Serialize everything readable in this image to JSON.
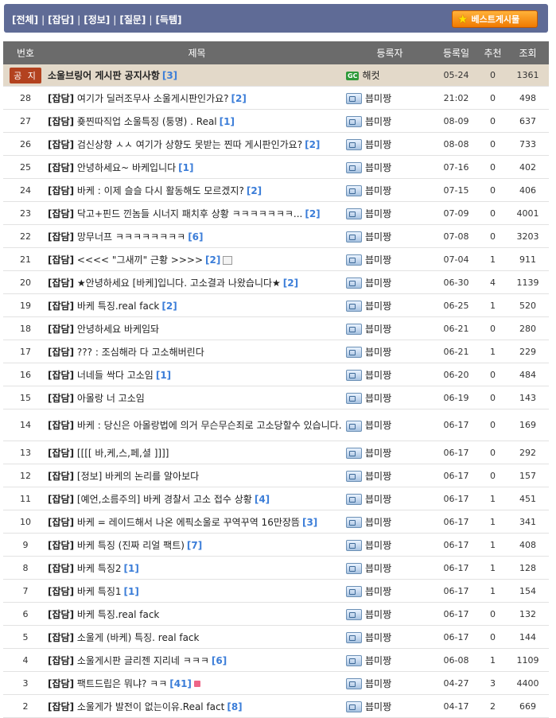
{
  "categories": [
    "[전체]",
    "[잡담]",
    "[정보]",
    "[질문]",
    "[득템]"
  ],
  "category_separator": "|",
  "best_button": {
    "label": "베스트게시물"
  },
  "columns": {
    "num": "번호",
    "title": "제목",
    "author": "등록자",
    "date": "등록일",
    "rec": "추천",
    "views": "조회"
  },
  "notice": {
    "badge": "공 지",
    "title": "소울브링어 게시판 공지사항",
    "comments": "[3]",
    "author": "해컷",
    "date": "05-24",
    "rec": "0",
    "views": "1361"
  },
  "posts": [
    {
      "num": "28",
      "cat": "[잡담]",
      "title": "여기가 딜러조무사 소울게시판인가요?",
      "comments": "[2]",
      "author": "븝미짱",
      "date": "21:02",
      "rec": "0",
      "views": "498"
    },
    {
      "num": "27",
      "cat": "[잡담]",
      "title": "죶찐따직업 소울특징 (퉁명) . Real",
      "comments": "[1]",
      "author": "븝미짱",
      "date": "08-09",
      "rec": "0",
      "views": "637"
    },
    {
      "num": "26",
      "cat": "[잡담]",
      "title": "검신상향 ㅅㅅ 여기가 상향도 못받는 찐따 게시판인가요?",
      "comments": "[2]",
      "author": "븝미짱",
      "date": "08-08",
      "rec": "0",
      "views": "733"
    },
    {
      "num": "25",
      "cat": "[잡담]",
      "title": "안녕하세요~ 바케입니다",
      "comments": "[1]",
      "author": "븝미짱",
      "date": "07-16",
      "rec": "0",
      "views": "402"
    },
    {
      "num": "24",
      "cat": "[잡담]",
      "title": "바케 : 이제 슬슬 다시 활동해도 모르겠지?",
      "comments": "[2]",
      "author": "븝미짱",
      "date": "07-15",
      "rec": "0",
      "views": "406"
    },
    {
      "num": "23",
      "cat": "[잡담]",
      "title": "닥고+핀드 낀놈들 시너지 패치후 상황 ㅋㅋㅋㅋㅋㅋㅋ...",
      "comments": "[2]",
      "author": "븝미짱",
      "date": "07-09",
      "rec": "0",
      "views": "4001"
    },
    {
      "num": "22",
      "cat": "[잡담]",
      "title": "망무너프 ㅋㅋㅋㅋㅋㅋㅋㅋ",
      "comments": "[6]",
      "author": "븝미짱",
      "date": "07-08",
      "rec": "0",
      "views": "3203"
    },
    {
      "num": "21",
      "cat": "[잡담]",
      "title": "<<<< \"그새끼\" 근황 >>>>",
      "comments": "[2]",
      "author": "븝미짱",
      "date": "07-04",
      "rec": "1",
      "views": "911",
      "img": true
    },
    {
      "num": "20",
      "cat": "[잡담]",
      "title": "★안녕하세요 [바케]입니다. 고소결과 나왔습니다★",
      "comments": "[2]",
      "author": "븝미짱",
      "date": "06-30",
      "rec": "4",
      "views": "1139"
    },
    {
      "num": "19",
      "cat": "[잡담]",
      "title": "바케 특징.real fack",
      "comments": "[2]",
      "author": "븝미짱",
      "date": "06-25",
      "rec": "1",
      "views": "520"
    },
    {
      "num": "18",
      "cat": "[잡담]",
      "title": "안녕하세요 바케임돠",
      "comments": "",
      "author": "븝미짱",
      "date": "06-21",
      "rec": "0",
      "views": "280"
    },
    {
      "num": "17",
      "cat": "[잡담]",
      "title": "??? : 조심해라 다 고소해버린다",
      "comments": "",
      "author": "븝미짱",
      "date": "06-21",
      "rec": "1",
      "views": "229"
    },
    {
      "num": "16",
      "cat": "[잡담]",
      "title": "너네들 싹다 고소임",
      "comments": "[1]",
      "author": "븝미짱",
      "date": "06-20",
      "rec": "0",
      "views": "484"
    },
    {
      "num": "15",
      "cat": "[잡담]",
      "title": "아몰랑 너 고소임",
      "comments": "",
      "author": "븝미짱",
      "date": "06-19",
      "rec": "0",
      "views": "143"
    },
    {
      "num": "14",
      "cat": "[잡담]",
      "title": "바케 : 당신은 아몰랑법에 의거 무슨무슨죄로 고소당할수 있습니다.",
      "comments": "",
      "author": "븝미짱",
      "date": "06-17",
      "rec": "0",
      "views": "169",
      "tall": true
    },
    {
      "num": "13",
      "cat": "[잡담]",
      "title": "[[[[ 바,케,스,페,셜 ]]]]",
      "comments": "",
      "author": "븝미짱",
      "date": "06-17",
      "rec": "0",
      "views": "292"
    },
    {
      "num": "12",
      "cat": "[잡담]",
      "title": "[정보] 바케의 논리를 알아보다",
      "comments": "",
      "author": "븝미짱",
      "date": "06-17",
      "rec": "0",
      "views": "157"
    },
    {
      "num": "11",
      "cat": "[잡담]",
      "title": "[예언,소름주의] 바케 경찰서 고소 접수 상황",
      "comments": "[4]",
      "author": "븝미짱",
      "date": "06-17",
      "rec": "1",
      "views": "451"
    },
    {
      "num": "10",
      "cat": "[잡담]",
      "title": "바케 = 레이드해서 나온 에픽소울로 꾸역꾸역 16만장뜸",
      "comments": "[3]",
      "author": "븝미짱",
      "date": "06-17",
      "rec": "1",
      "views": "341"
    },
    {
      "num": "9",
      "cat": "[잡담]",
      "title": "바케 특징 (진짜 리얼 팩트)",
      "comments": "[7]",
      "author": "븝미짱",
      "date": "06-17",
      "rec": "1",
      "views": "408"
    },
    {
      "num": "8",
      "cat": "[잡담]",
      "title": "바케 특징2",
      "comments": "[1]",
      "author": "븝미짱",
      "date": "06-17",
      "rec": "1",
      "views": "128"
    },
    {
      "num": "7",
      "cat": "[잡담]",
      "title": "바케 특징1",
      "comments": "[1]",
      "author": "븝미짱",
      "date": "06-17",
      "rec": "1",
      "views": "154"
    },
    {
      "num": "6",
      "cat": "[잡담]",
      "title": "바케 특징.real fack",
      "comments": "",
      "author": "븝미짱",
      "date": "06-17",
      "rec": "0",
      "views": "132"
    },
    {
      "num": "5",
      "cat": "[잡담]",
      "title": "소울게 (바케) 특징. real fack",
      "comments": "",
      "author": "븝미짱",
      "date": "06-17",
      "rec": "0",
      "views": "144"
    },
    {
      "num": "4",
      "cat": "[잡담]",
      "title": "소울게시판 글리젠 지리네 ㅋㅋㅋ",
      "comments": "[6]",
      "author": "븝미짱",
      "date": "06-08",
      "rec": "1",
      "views": "1109"
    },
    {
      "num": "3",
      "cat": "[잡담]",
      "title": "팩트드립은 뭐냐? ㅋㅋ",
      "comments": "[41]",
      "author": "븝미짱",
      "date": "04-27",
      "rec": "3",
      "views": "4400",
      "new": true
    },
    {
      "num": "2",
      "cat": "[잡담]",
      "title": "소울게가 발전이 없는이유.Real fact",
      "comments": "[8]",
      "author": "븝미짱",
      "date": "04-17",
      "rec": "2",
      "views": "669"
    }
  ]
}
